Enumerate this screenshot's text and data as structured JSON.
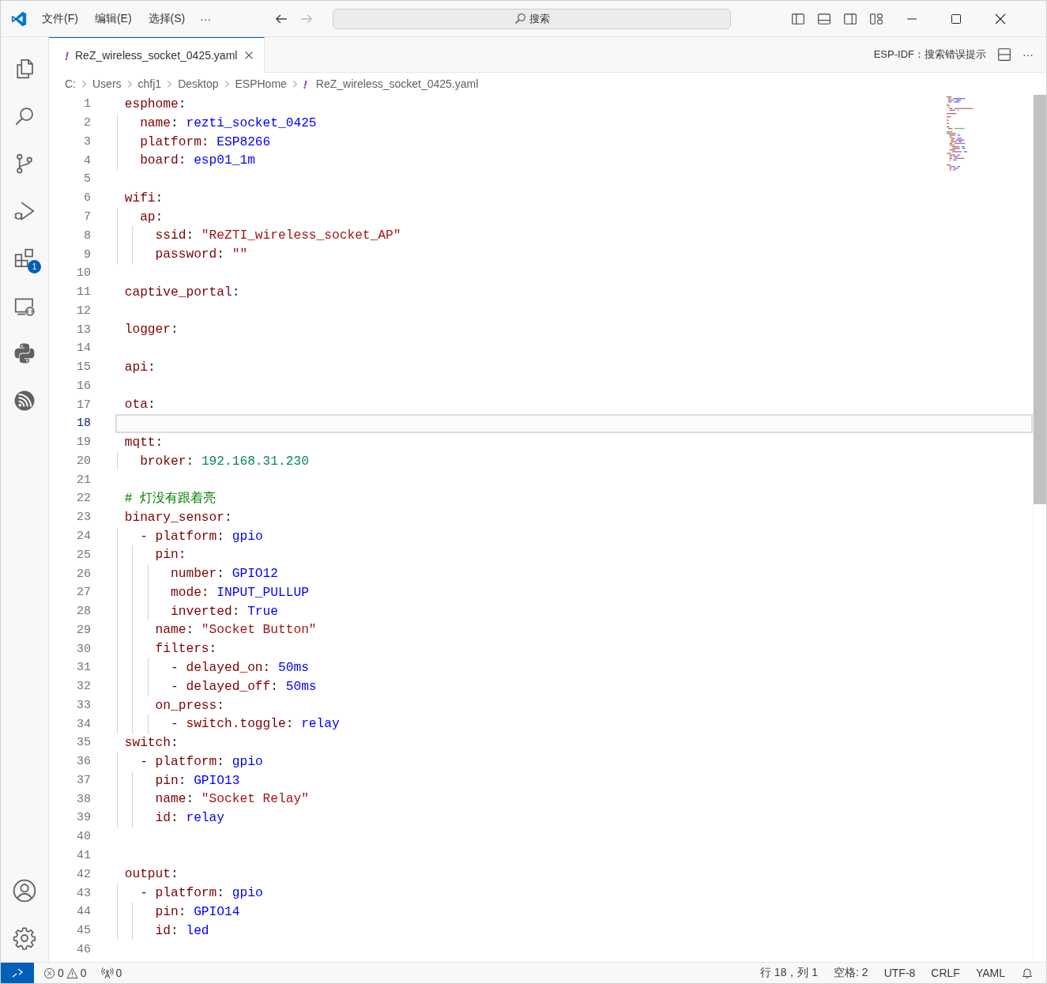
{
  "title_bar": {
    "menu": [
      "文件(F)",
      "编辑(E)",
      "选择(S)"
    ],
    "more": "···",
    "search": {
      "placeholder": "搜索"
    }
  },
  "activity_bar": {
    "items": [
      {
        "kind": "files"
      },
      {
        "kind": "search"
      },
      {
        "kind": "source-control"
      },
      {
        "kind": "run-debug"
      },
      {
        "kind": "extensions",
        "badge": "1"
      },
      {
        "kind": "remote"
      },
      {
        "kind": "python"
      },
      {
        "kind": "espressif"
      }
    ],
    "bottom_items": [
      {
        "kind": "account"
      },
      {
        "kind": "settings"
      }
    ]
  },
  "tabs": [
    {
      "icon": "!",
      "label": "ReZ_wireless_socket_0425.yaml",
      "selected": true
    }
  ],
  "editor_actions": {
    "label": "ESP-IDF：搜索错误提示",
    "more": "···"
  },
  "breadcrumbs": [
    {
      "label": "C:"
    },
    {
      "label": "Users"
    },
    {
      "label": "chfj1"
    },
    {
      "label": "Desktop"
    },
    {
      "label": "ESPHome"
    },
    {
      "label": "ReZ_wireless_socket_0425.yaml",
      "icon": "!"
    }
  ],
  "editor": {
    "lines": [
      {
        "number": "1",
        "current": false,
        "tokens": [
          {
            "text": "esphome",
            "kind": "key"
          },
          {
            "text": ":",
            "kind": "plain"
          }
        ],
        "children": [
          {
            "number": "2",
            "current": false,
            "tokens": [
              {
                "text": "name",
                "kind": "key"
              },
              {
                "text": ":",
                "kind": "plain"
              },
              {
                "text": "rezti_socket_0425",
                "kind": "value"
              }
            ]
          },
          {
            "number": "3",
            "current": false,
            "tokens": [
              {
                "text": "platform",
                "kind": "key"
              },
              {
                "text": ":",
                "kind": "plain"
              },
              {
                "text": "ESP8266",
                "kind": "value"
              }
            ]
          },
          {
            "number": "4",
            "current": false,
            "tokens": [
              {
                "text": "board",
                "kind": "key"
              },
              {
                "text": ":",
                "kind": "plain"
              },
              {
                "text": "esp01_1m",
                "kind": "value"
              }
            ]
          }
        ]
      },
      {
        "number": "5",
        "current": false
      },
      {
        "number": "6",
        "current": false,
        "tokens": [
          {
            "text": "wifi",
            "kind": "key"
          },
          {
            "text": ":",
            "kind": "plain"
          }
        ],
        "children": [
          {
            "number": "7",
            "current": false,
            "tokens": [
              {
                "text": "ap",
                "kind": "key"
              },
              {
                "text": ":",
                "kind": "plain"
              }
            ],
            "children": [
              {
                "number": "8",
                "current": false,
                "tokens": [
                  {
                    "text": "ssid",
                    "kind": "key"
                  },
                  {
                    "text": ":",
                    "kind": "plain"
                  },
                  {
                    "text": "\"ReZTI_wireless_socket_AP\"",
                    "kind": "string"
                  }
                ]
              },
              {
                "number": "9",
                "current": false,
                "tokens": [
                  {
                    "text": "password",
                    "kind": "key"
                  },
                  {
                    "text": ":",
                    "kind": "plain"
                  },
                  {
                    "text": "\"\"",
                    "kind": "string"
                  }
                ]
              }
            ]
          }
        ]
      },
      {
        "number": "10",
        "current": false
      },
      {
        "number": "11",
        "current": false,
        "tokens": [
          {
            "text": "captive_portal",
            "kind": "key"
          },
          {
            "text": ":",
            "kind": "plain"
          }
        ]
      },
      {
        "number": "12",
        "current": false
      },
      {
        "number": "13",
        "current": false,
        "tokens": [
          {
            "text": "logger",
            "kind": "key"
          },
          {
            "text": ":",
            "kind": "plain"
          }
        ]
      },
      {
        "number": "14",
        "current": false
      },
      {
        "number": "15",
        "current": false,
        "tokens": [
          {
            "text": "api",
            "kind": "key"
          },
          {
            "text": ":",
            "kind": "plain"
          }
        ]
      },
      {
        "number": "16",
        "current": false
      },
      {
        "number": "17",
        "current": false,
        "tokens": [
          {
            "text": "ota",
            "kind": "key"
          },
          {
            "text": ":",
            "kind": "plain"
          }
        ]
      },
      {
        "number": "18",
        "current": true
      },
      {
        "number": "19",
        "current": false,
        "tokens": [
          {
            "text": "mqtt",
            "kind": "key"
          },
          {
            "text": ":",
            "kind": "plain"
          }
        ],
        "children": [
          {
            "number": "20",
            "current": false,
            "tokens": [
              {
                "text": "broker",
                "kind": "key"
              },
              {
                "text": ":",
                "kind": "plain"
              },
              {
                "text": "192.168.31.230",
                "kind": "number"
              }
            ]
          }
        ]
      },
      {
        "number": "21",
        "current": false
      },
      {
        "number": "22",
        "current": false,
        "tokens": [
          {
            "text": "# 灯没有跟着亮",
            "kind": "comment"
          }
        ]
      },
      {
        "number": "23",
        "current": false,
        "tokens": [
          {
            "text": "binary_sensor",
            "kind": "key"
          },
          {
            "text": ":",
            "kind": "plain"
          }
        ],
        "children": [
          {
            "number": "24",
            "current": false,
            "tokens": [
              {
                "text": "-",
                "kind": "plain"
              },
              {
                "text": "platform",
                "kind": "key"
              },
              {
                "text": ":",
                "kind": "plain"
              },
              {
                "text": "gpio",
                "kind": "value"
              }
            ],
            "children": [
              {
                "number": "25",
                "current": false,
                "tokens": [
                  {
                    "text": "pin",
                    "kind": "key"
                  },
                  {
                    "text": ":",
                    "kind": "plain"
                  }
                ],
                "children": [
                  {
                    "number": "26",
                    "current": false,
                    "tokens": [
                      {
                        "text": "number",
                        "kind": "key"
                      },
                      {
                        "text": ":",
                        "kind": "plain"
                      },
                      {
                        "text": "GPIO12",
                        "kind": "value"
                      }
                    ]
                  },
                  {
                    "number": "27",
                    "current": false,
                    "tokens": [
                      {
                        "text": "mode",
                        "kind": "key"
                      },
                      {
                        "text": ":",
                        "kind": "plain"
                      },
                      {
                        "text": "INPUT_PULLUP",
                        "kind": "value"
                      }
                    ]
                  },
                  {
                    "number": "28",
                    "current": false,
                    "tokens": [
                      {
                        "text": "inverted",
                        "kind": "key"
                      },
                      {
                        "text": ":",
                        "kind": "plain"
                      },
                      {
                        "text": "True",
                        "kind": "value"
                      }
                    ]
                  }
                ]
              },
              {
                "number": "29",
                "current": false,
                "tokens": [
                  {
                    "text": "name",
                    "kind": "key"
                  },
                  {
                    "text": ":",
                    "kind": "plain"
                  },
                  {
                    "text": "\"Socket Button\"",
                    "kind": "string"
                  }
                ]
              },
              {
                "number": "30",
                "current": false,
                "tokens": [
                  {
                    "text": "filters",
                    "kind": "key"
                  },
                  {
                    "text": ":",
                    "kind": "plain"
                  }
                ],
                "children": [
                  {
                    "number": "31",
                    "current": false,
                    "tokens": [
                      {
                        "text": "-",
                        "kind": "plain"
                      },
                      {
                        "text": "delayed_on",
                        "kind": "key"
                      },
                      {
                        "text": ":",
                        "kind": "plain"
                      },
                      {
                        "text": "50ms",
                        "kind": "value"
                      }
                    ]
                  },
                  {
                    "number": "32",
                    "current": false,
                    "tokens": [
                      {
                        "text": "-",
                        "kind": "plain"
                      },
                      {
                        "text": "delayed_off",
                        "kind": "key"
                      },
                      {
                        "text": ":",
                        "kind": "plain"
                      },
                      {
                        "text": "50ms",
                        "kind": "value"
                      }
                    ]
                  }
                ]
              },
              {
                "number": "33",
                "current": false,
                "tokens": [
                  {
                    "text": "on_press",
                    "kind": "key"
                  },
                  {
                    "text": ":",
                    "kind": "plain"
                  }
                ],
                "children": [
                  {
                    "number": "34",
                    "current": false,
                    "tokens": [
                      {
                        "text": "-",
                        "kind": "plain"
                      },
                      {
                        "text": "switch.toggle",
                        "kind": "key"
                      },
                      {
                        "text": ":",
                        "kind": "plain"
                      },
                      {
                        "text": "relay",
                        "kind": "value"
                      }
                    ]
                  }
                ]
              }
            ]
          }
        ]
      },
      {
        "number": "35",
        "current": false,
        "tokens": [
          {
            "text": "switch",
            "kind": "key"
          },
          {
            "text": ":",
            "kind": "plain"
          }
        ],
        "children": [
          {
            "number": "36",
            "current": false,
            "tokens": [
              {
                "text": "-",
                "kind": "plain"
              },
              {
                "text": "platform",
                "kind": "key"
              },
              {
                "text": ":",
                "kind": "plain"
              },
              {
                "text": "gpio",
                "kind": "value"
              }
            ],
            "children": [
              {
                "number": "37",
                "current": false,
                "tokens": [
                  {
                    "text": "pin",
                    "kind": "key"
                  },
                  {
                    "text": ":",
                    "kind": "plain"
                  },
                  {
                    "text": "GPIO13",
                    "kind": "value"
                  }
                ]
              },
              {
                "number": "38",
                "current": false,
                "tokens": [
                  {
                    "text": "name",
                    "kind": "key"
                  },
                  {
                    "text": ":",
                    "kind": "plain"
                  },
                  {
                    "text": "\"Socket Relay\"",
                    "kind": "string"
                  }
                ]
              },
              {
                "number": "39",
                "current": false,
                "tokens": [
                  {
                    "text": "id",
                    "kind": "key"
                  },
                  {
                    "text": ":",
                    "kind": "plain"
                  },
                  {
                    "text": "relay",
                    "kind": "value"
                  }
                ]
              }
            ]
          }
        ]
      },
      {
        "number": "40",
        "current": false
      },
      {
        "number": "41",
        "current": false
      },
      {
        "number": "42",
        "current": false,
        "tokens": [
          {
            "text": "output",
            "kind": "key"
          },
          {
            "text": ":",
            "kind": "plain"
          }
        ],
        "children": [
          {
            "number": "43",
            "current": false,
            "tokens": [
              {
                "text": "-",
                "kind": "plain"
              },
              {
                "text": "platform",
                "kind": "key"
              },
              {
                "text": ":",
                "kind": "plain"
              },
              {
                "text": "gpio",
                "kind": "value"
              }
            ],
            "children": [
              {
                "number": "44",
                "current": false,
                "tokens": [
                  {
                    "text": "pin",
                    "kind": "key"
                  },
                  {
                    "text": ":",
                    "kind": "plain"
                  },
                  {
                    "text": "GPIO14",
                    "kind": "value"
                  }
                ]
              },
              {
                "number": "45",
                "current": false,
                "tokens": [
                  {
                    "text": "id",
                    "kind": "key"
                  },
                  {
                    "text": ":",
                    "kind": "plain"
                  },
                  {
                    "text": "led",
                    "kind": "value"
                  }
                ]
              }
            ]
          }
        ]
      },
      {
        "number": "46",
        "current": false
      }
    ]
  },
  "status_bar": {
    "errors": "0",
    "warnings": "0",
    "ports": "0",
    "items": [
      "行 18，列 1",
      "空格: 2",
      "UTF-8",
      "CRLF",
      "YAML"
    ]
  }
}
